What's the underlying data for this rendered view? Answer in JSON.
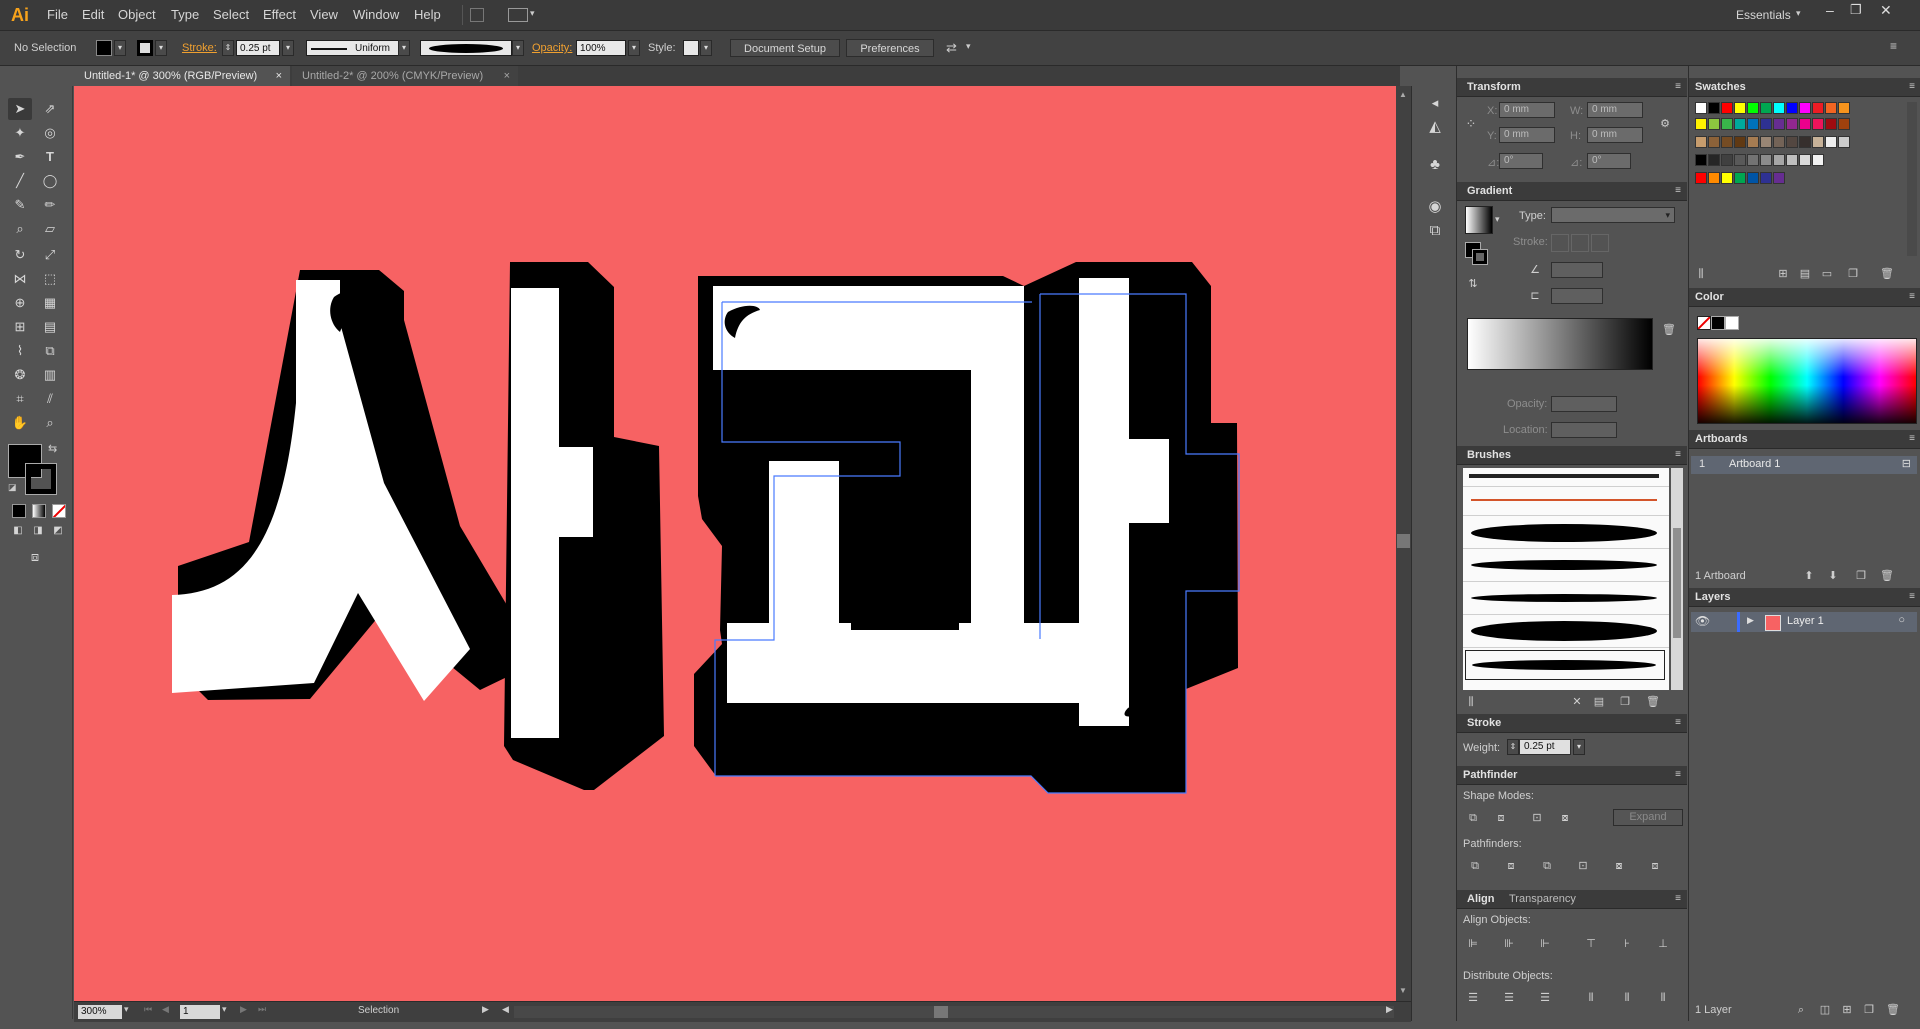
{
  "app": {
    "logo": "Ai",
    "workspace": "Essentials"
  },
  "menu": [
    "File",
    "Edit",
    "Object",
    "Type",
    "Select",
    "Effect",
    "View",
    "Window",
    "Help"
  ],
  "control": {
    "selection_status": "No Selection",
    "stroke_label": "Stroke:",
    "stroke_weight": "0.25 pt",
    "stroke_profile": "Uniform",
    "opacity_label": "Opacity:",
    "opacity_value": "100%",
    "style_label": "Style:",
    "doc_setup": "Document Setup",
    "preferences": "Preferences"
  },
  "tabs": [
    {
      "label": "Untitled-1* @ 300% (RGB/Preview)",
      "close": "×"
    },
    {
      "label": "Untitled-2* @ 200% (CMYK/Preview)",
      "close": "×"
    }
  ],
  "artwork": {
    "text": "사과",
    "background_color": "#f76263"
  },
  "status": {
    "zoom": "300%",
    "page": "1",
    "tool": "Selection"
  },
  "transform": {
    "title": "Transform",
    "x_label": "X:",
    "x_value": "0 mm",
    "y_label": "Y:",
    "y_value": "0 mm",
    "w_label": "W:",
    "w_value": "0 mm",
    "h_label": "H:",
    "h_value": "0 mm",
    "rotate_label": "⊿:",
    "rotate_value": "0°",
    "shear_label": "⊿:",
    "shear_value": "0°"
  },
  "gradient": {
    "title": "Gradient",
    "type_label": "Type:",
    "stroke_label": "Stroke:",
    "opacity_label": "Opacity:",
    "location_label": "Location:"
  },
  "brushes": {
    "title": "Brushes"
  },
  "stroke_panel": {
    "title": "Stroke",
    "weight_label": "Weight:",
    "weight_value": "0.25 pt"
  },
  "pathfinder": {
    "title": "Pathfinder",
    "shape_modes": "Shape Modes:",
    "expand": "Expand",
    "pathfinders": "Pathfinders:"
  },
  "align": {
    "title": "Align",
    "tab2": "Transparency",
    "align_objects": "Align Objects:",
    "distribute_objects": "Distribute Objects:"
  },
  "swatches": {
    "title": "Swatches"
  },
  "color": {
    "title": "Color"
  },
  "artboards": {
    "title": "Artboards",
    "items": [
      {
        "num": "1",
        "name": "Artboard 1"
      }
    ],
    "count": "1 Artboard"
  },
  "layers": {
    "title": "Layers",
    "items": [
      {
        "name": "Layer 1"
      }
    ],
    "count": "1 Layer"
  },
  "colors": {
    "swatch_row1": [
      "#ffffff",
      "#000000",
      "#ff0000",
      "#ffff00",
      "#00ff00",
      "#00a651",
      "#00ffff",
      "#0000ff",
      "#ff00ff",
      "#ed1c24",
      "#f26522",
      "#f7941d"
    ],
    "swatch_row2": [
      "#fff200",
      "#8dc63f",
      "#39b54a",
      "#00a99d",
      "#0072bc",
      "#2e3192",
      "#662d91",
      "#92278f",
      "#ec008c",
      "#ed145b",
      "#9e0b0f",
      "#a0410d"
    ],
    "swatch_row3": [
      "#c69c6d",
      "#8c6239",
      "#754c24",
      "#603913",
      "#a67c52",
      "#998675",
      "#736357",
      "#534741",
      "#362f2d",
      "#c7b299",
      "#eeeeee",
      "#cccccc"
    ],
    "swatch_row4": [
      "#000000",
      "#262626",
      "#404040",
      "#595959",
      "#737373",
      "#8c8c8c",
      "#a6a6a6",
      "#bfbfbf",
      "#d9d9d9",
      "#f2f2f2"
    ],
    "swatch_row5": [
      "#ff0000",
      "#ff8a00",
      "#ffff00",
      "#00a651",
      "#0054a6",
      "#2e3192",
      "#662d91"
    ]
  }
}
